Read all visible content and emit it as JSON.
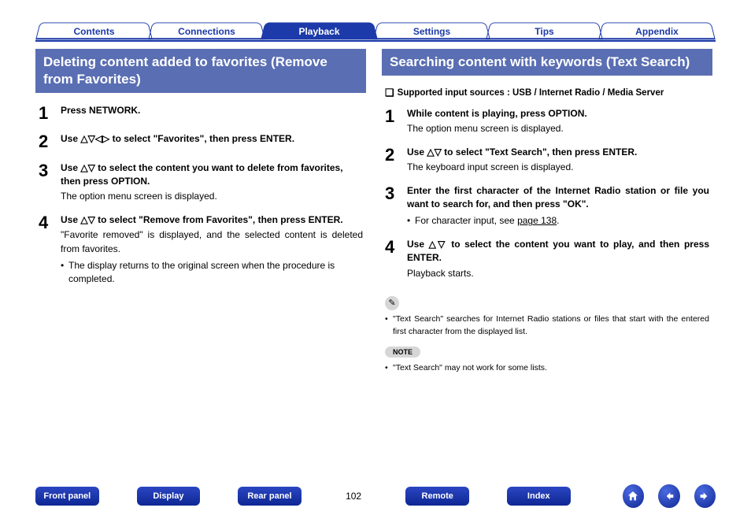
{
  "tabs": [
    {
      "label": "Contents"
    },
    {
      "label": "Connections"
    },
    {
      "label": "Playback"
    },
    {
      "label": "Settings"
    },
    {
      "label": "Tips"
    },
    {
      "label": "Appendix"
    }
  ],
  "activeTab": "Playback",
  "left": {
    "title": "Deleting content added to favorites (Remove from Favorites)",
    "steps": [
      {
        "n": "1",
        "bold": "Press NETWORK."
      },
      {
        "n": "2",
        "bold": "Use △▽◁▷ to select \"Favorites\", then press ENTER."
      },
      {
        "n": "3",
        "bold": "Use △▽ to select the content you want to delete from favorites, then press OPTION.",
        "desc": "The option menu screen is displayed."
      },
      {
        "n": "4",
        "bold": "Use △▽ to select \"Remove from Favorites\", then press ENTER.",
        "desc": "\"Favorite removed\" is displayed, and the selected content is deleted from favorites.",
        "bullet": "The display returns to the original screen when the procedure is completed."
      }
    ]
  },
  "right": {
    "title": "Searching content with keywords (Text Search)",
    "support_line": "Supported input sources : USB / Internet Radio / Media Server",
    "steps": [
      {
        "n": "1",
        "bold": "While content is playing, press OPTION.",
        "desc": "The option menu screen is displayed."
      },
      {
        "n": "2",
        "bold": "Use △▽ to select \"Text Search\", then press ENTER.",
        "desc": "The keyboard input screen is displayed."
      },
      {
        "n": "3",
        "bold": "Enter the first character of the Internet Radio station or file you want to search for, and then press \"OK\".",
        "bullet": "For character input, see ",
        "link": "page 138",
        "bullet_tail": "."
      },
      {
        "n": "4",
        "bold": "Use △▽ to select the content you want to play, and then press ENTER.",
        "desc": "Playback starts."
      }
    ],
    "info_bullet": "\"Text Search\" searches for Internet Radio stations or files that start with the entered first character from the displayed list.",
    "note_label": "NOTE",
    "note_bullet": "\"Text Search\" may not work for some lists."
  },
  "footer": {
    "buttons": [
      "Front panel",
      "Display",
      "Rear panel",
      "Remote",
      "Index"
    ],
    "page": "102"
  }
}
